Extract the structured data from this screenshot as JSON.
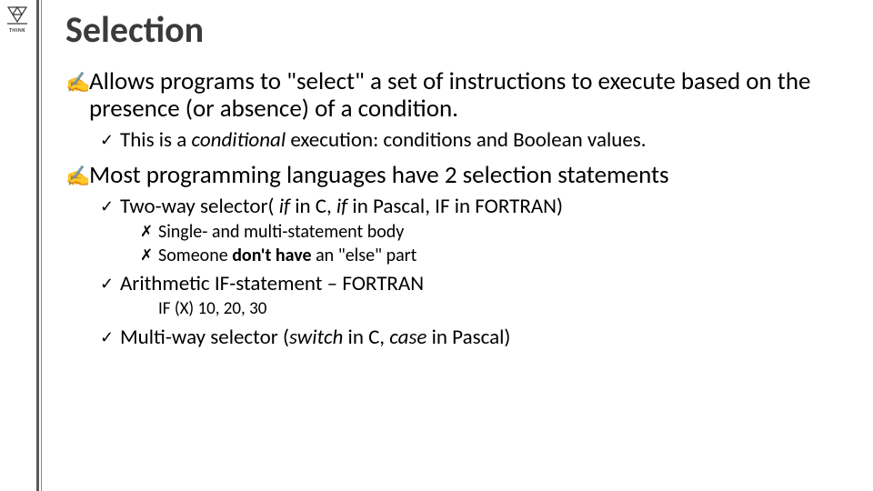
{
  "logo_label": "THINK",
  "title": "Selection",
  "bullets": {
    "hand": "✍",
    "check": "✓",
    "cross": "✗"
  },
  "p1": {
    "pre": "Allows programs to \"select\" a set of instructions to execute based on the presence (or absence) of a condition."
  },
  "p1a": {
    "a": "This is a ",
    "b": "conditional",
    "c": " execution: conditions and Boolean values."
  },
  "p2": "Most programming languages have 2 selection statements",
  "p2a": {
    "a": "Two-way selector( ",
    "b": "if",
    "c": " in C, ",
    "d": "if",
    "e": " in Pascal, IF in FORTRAN)"
  },
  "p2a1": "Single- and multi-statement body",
  "p2a2": {
    "a": "Someone  ",
    "b": "don't have",
    "c": " an \"else\" part"
  },
  "p2b": "Arithmetic IF-statement – FORTRAN",
  "p2b_code": "IF (X) 10, 20, 30",
  "p2c": {
    "a": "Multi-way selector (",
    "b": "switch",
    "c": " in C, ",
    "d": "case",
    "e": " in Pascal)"
  }
}
